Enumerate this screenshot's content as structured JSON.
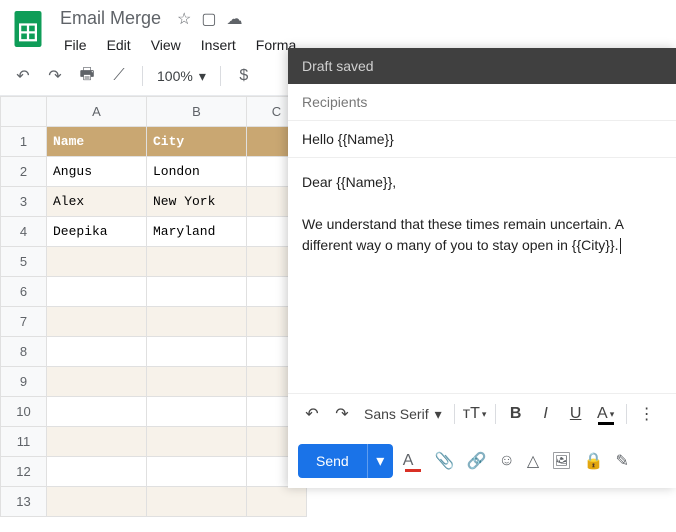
{
  "doc": {
    "title": "Email Merge"
  },
  "menu": {
    "file": "File",
    "edit": "Edit",
    "view": "View",
    "insert": "Insert",
    "format": "Forma"
  },
  "toolbar": {
    "zoom": "100%",
    "currency": "$"
  },
  "sheet": {
    "cols": [
      "A",
      "B",
      "C"
    ],
    "headers": {
      "name": "Name",
      "city": "City"
    },
    "rows": [
      {
        "name": "Angus",
        "city": "London"
      },
      {
        "name": "Alex",
        "city": "New York"
      },
      {
        "name": "Deepika",
        "city": "Maryland"
      }
    ]
  },
  "compose": {
    "status": "Draft saved",
    "recipients_label": "Recipients",
    "subject": "Hello {{Name}}",
    "body": "Dear {{Name}},\n\nWe understand that these times remain uncertain. A different way o many of you to stay open in {{City}}.",
    "font": "Sans Serif",
    "send": "Send"
  },
  "icons": {
    "star": "☆",
    "folder_move": "▢",
    "cloud": "☁",
    "undo": "↶",
    "redo": "↷",
    "print": "🖶",
    "paint": "⟋",
    "dropdown": "▾",
    "size": "тT",
    "bold": "B",
    "italic": "I",
    "underline": "U",
    "A": "A",
    "attach": "📎",
    "link": "🔗",
    "emoji": "☺",
    "drive": "△",
    "image": "🖼",
    "lock": "🔒",
    "pen": "✎",
    "more": "⋮"
  }
}
